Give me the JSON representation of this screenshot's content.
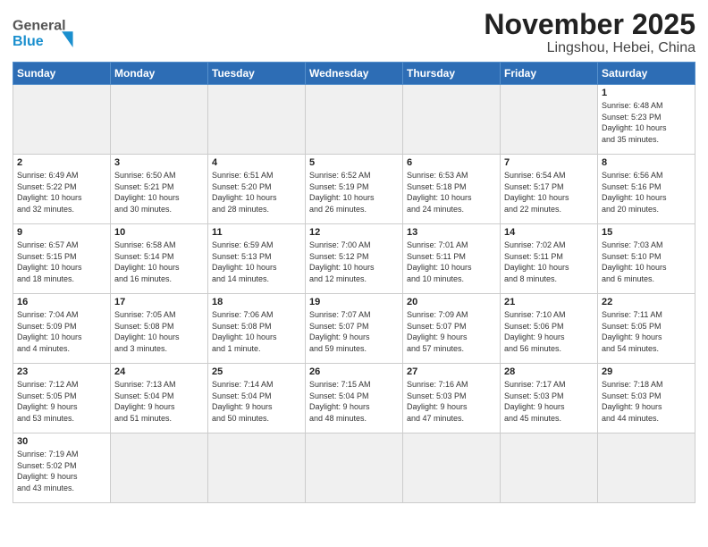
{
  "header": {
    "title": "November 2025",
    "subtitle": "Lingshou, Hebei, China",
    "logo_line1": "General",
    "logo_line2": "Blue"
  },
  "weekdays": [
    "Sunday",
    "Monday",
    "Tuesday",
    "Wednesday",
    "Thursday",
    "Friday",
    "Saturday"
  ],
  "weeks": [
    [
      {
        "day": "",
        "info": ""
      },
      {
        "day": "",
        "info": ""
      },
      {
        "day": "",
        "info": ""
      },
      {
        "day": "",
        "info": ""
      },
      {
        "day": "",
        "info": ""
      },
      {
        "day": "",
        "info": ""
      },
      {
        "day": "1",
        "info": "Sunrise: 6:48 AM\nSunset: 5:23 PM\nDaylight: 10 hours\nand 35 minutes."
      }
    ],
    [
      {
        "day": "2",
        "info": "Sunrise: 6:49 AM\nSunset: 5:22 PM\nDaylight: 10 hours\nand 32 minutes."
      },
      {
        "day": "3",
        "info": "Sunrise: 6:50 AM\nSunset: 5:21 PM\nDaylight: 10 hours\nand 30 minutes."
      },
      {
        "day": "4",
        "info": "Sunrise: 6:51 AM\nSunset: 5:20 PM\nDaylight: 10 hours\nand 28 minutes."
      },
      {
        "day": "5",
        "info": "Sunrise: 6:52 AM\nSunset: 5:19 PM\nDaylight: 10 hours\nand 26 minutes."
      },
      {
        "day": "6",
        "info": "Sunrise: 6:53 AM\nSunset: 5:18 PM\nDaylight: 10 hours\nand 24 minutes."
      },
      {
        "day": "7",
        "info": "Sunrise: 6:54 AM\nSunset: 5:17 PM\nDaylight: 10 hours\nand 22 minutes."
      },
      {
        "day": "8",
        "info": "Sunrise: 6:56 AM\nSunset: 5:16 PM\nDaylight: 10 hours\nand 20 minutes."
      }
    ],
    [
      {
        "day": "9",
        "info": "Sunrise: 6:57 AM\nSunset: 5:15 PM\nDaylight: 10 hours\nand 18 minutes."
      },
      {
        "day": "10",
        "info": "Sunrise: 6:58 AM\nSunset: 5:14 PM\nDaylight: 10 hours\nand 16 minutes."
      },
      {
        "day": "11",
        "info": "Sunrise: 6:59 AM\nSunset: 5:13 PM\nDaylight: 10 hours\nand 14 minutes."
      },
      {
        "day": "12",
        "info": "Sunrise: 7:00 AM\nSunset: 5:12 PM\nDaylight: 10 hours\nand 12 minutes."
      },
      {
        "day": "13",
        "info": "Sunrise: 7:01 AM\nSunset: 5:11 PM\nDaylight: 10 hours\nand 10 minutes."
      },
      {
        "day": "14",
        "info": "Sunrise: 7:02 AM\nSunset: 5:11 PM\nDaylight: 10 hours\nand 8 minutes."
      },
      {
        "day": "15",
        "info": "Sunrise: 7:03 AM\nSunset: 5:10 PM\nDaylight: 10 hours\nand 6 minutes."
      }
    ],
    [
      {
        "day": "16",
        "info": "Sunrise: 7:04 AM\nSunset: 5:09 PM\nDaylight: 10 hours\nand 4 minutes."
      },
      {
        "day": "17",
        "info": "Sunrise: 7:05 AM\nSunset: 5:08 PM\nDaylight: 10 hours\nand 3 minutes."
      },
      {
        "day": "18",
        "info": "Sunrise: 7:06 AM\nSunset: 5:08 PM\nDaylight: 10 hours\nand 1 minute."
      },
      {
        "day": "19",
        "info": "Sunrise: 7:07 AM\nSunset: 5:07 PM\nDaylight: 9 hours\nand 59 minutes."
      },
      {
        "day": "20",
        "info": "Sunrise: 7:09 AM\nSunset: 5:07 PM\nDaylight: 9 hours\nand 57 minutes."
      },
      {
        "day": "21",
        "info": "Sunrise: 7:10 AM\nSunset: 5:06 PM\nDaylight: 9 hours\nand 56 minutes."
      },
      {
        "day": "22",
        "info": "Sunrise: 7:11 AM\nSunset: 5:05 PM\nDaylight: 9 hours\nand 54 minutes."
      }
    ],
    [
      {
        "day": "23",
        "info": "Sunrise: 7:12 AM\nSunset: 5:05 PM\nDaylight: 9 hours\nand 53 minutes."
      },
      {
        "day": "24",
        "info": "Sunrise: 7:13 AM\nSunset: 5:04 PM\nDaylight: 9 hours\nand 51 minutes."
      },
      {
        "day": "25",
        "info": "Sunrise: 7:14 AM\nSunset: 5:04 PM\nDaylight: 9 hours\nand 50 minutes."
      },
      {
        "day": "26",
        "info": "Sunrise: 7:15 AM\nSunset: 5:04 PM\nDaylight: 9 hours\nand 48 minutes."
      },
      {
        "day": "27",
        "info": "Sunrise: 7:16 AM\nSunset: 5:03 PM\nDaylight: 9 hours\nand 47 minutes."
      },
      {
        "day": "28",
        "info": "Sunrise: 7:17 AM\nSunset: 5:03 PM\nDaylight: 9 hours\nand 45 minutes."
      },
      {
        "day": "29",
        "info": "Sunrise: 7:18 AM\nSunset: 5:03 PM\nDaylight: 9 hours\nand 44 minutes."
      }
    ],
    [
      {
        "day": "30",
        "info": "Sunrise: 7:19 AM\nSunset: 5:02 PM\nDaylight: 9 hours\nand 43 minutes."
      },
      {
        "day": "",
        "info": ""
      },
      {
        "day": "",
        "info": ""
      },
      {
        "day": "",
        "info": ""
      },
      {
        "day": "",
        "info": ""
      },
      {
        "day": "",
        "info": ""
      },
      {
        "day": "",
        "info": ""
      }
    ]
  ]
}
